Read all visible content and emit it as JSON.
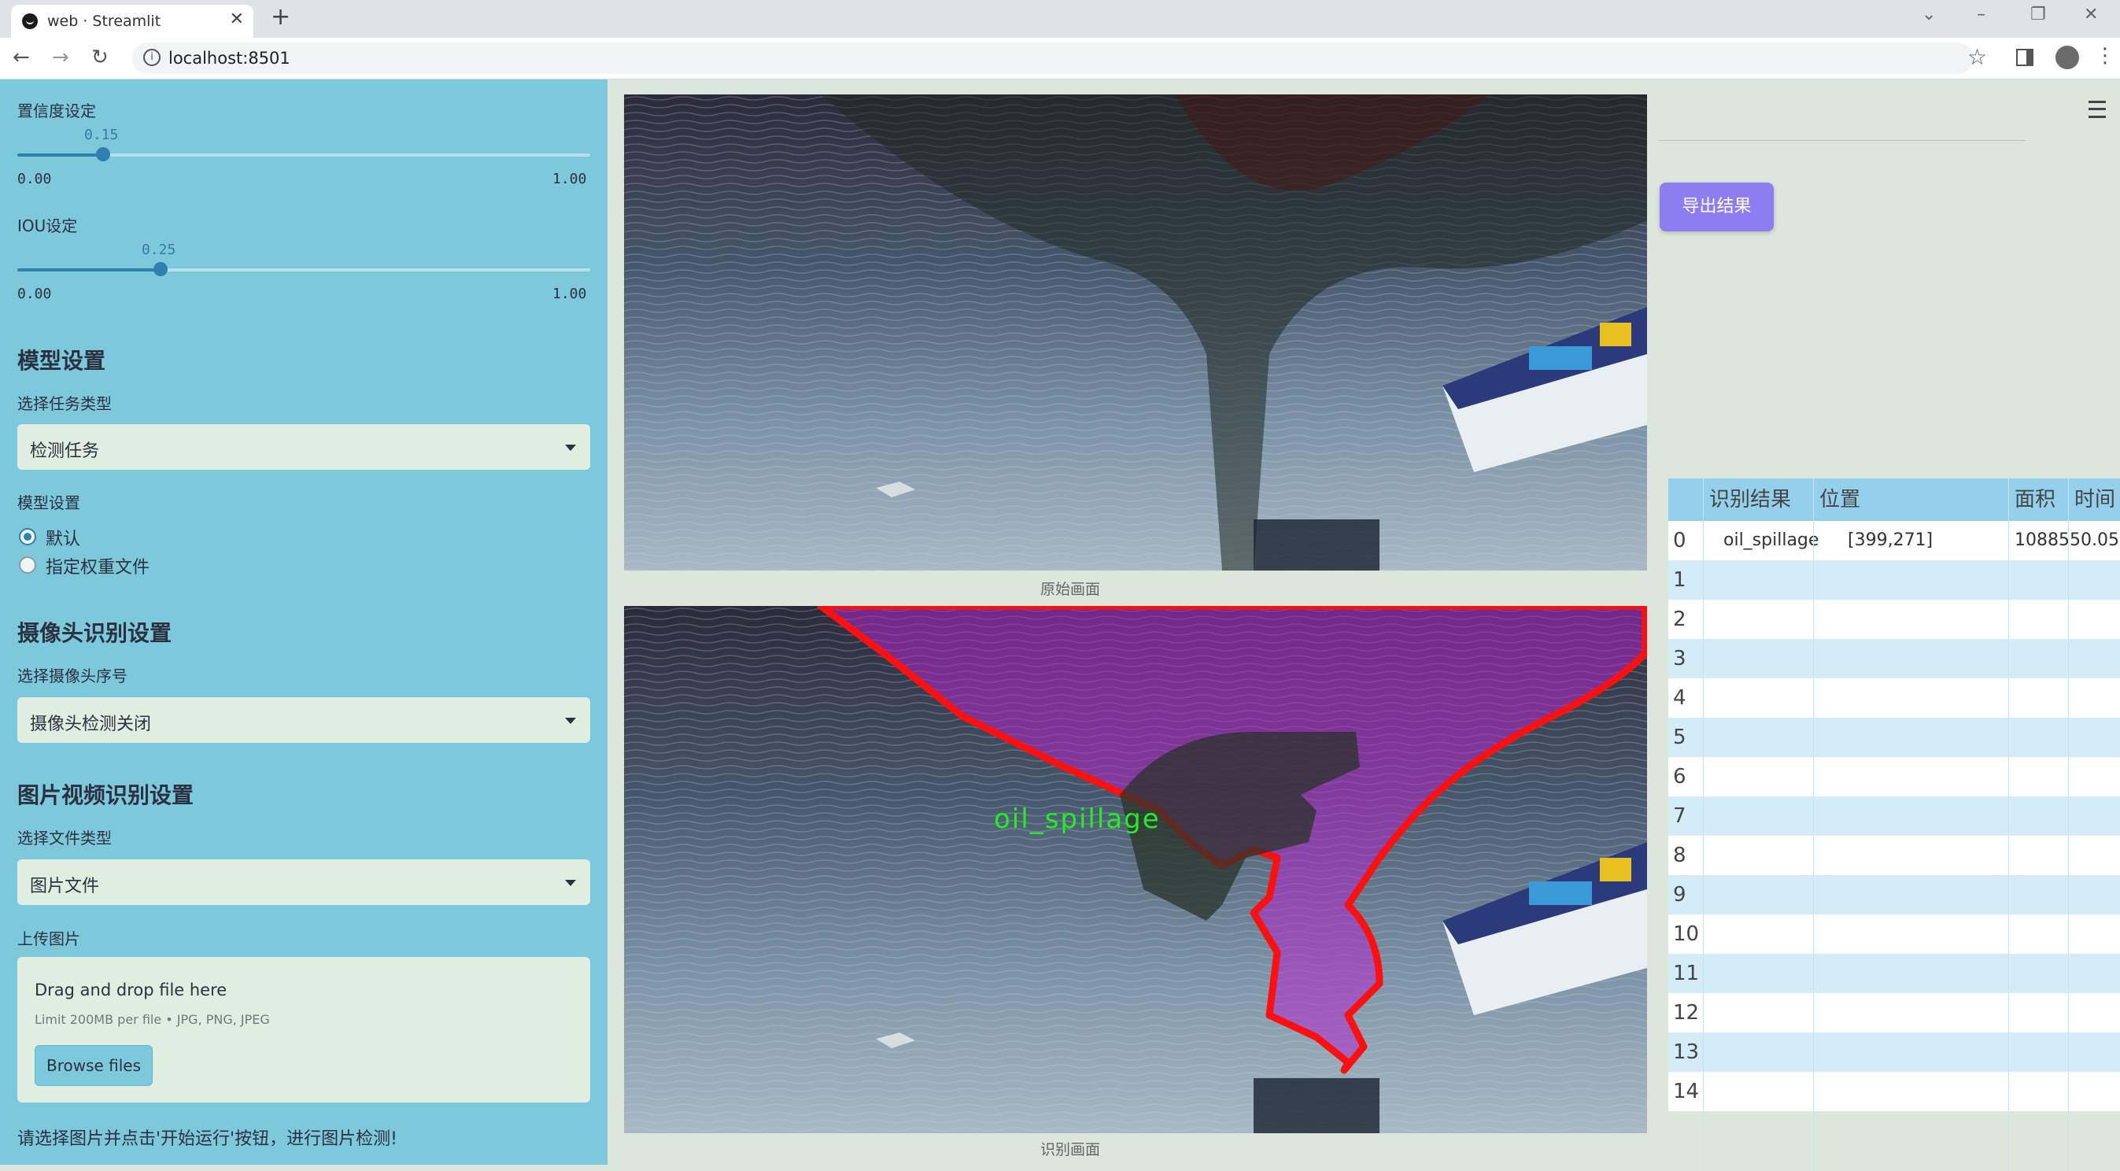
{
  "browser": {
    "tab_title": "web · Streamlit",
    "url": "localhost:8501"
  },
  "sidebar": {
    "confidence": {
      "label": "置信度设定",
      "value": 0.15,
      "value_text": "0.15",
      "min": "0.00",
      "max": "1.00"
    },
    "iou": {
      "label": "IOU设定",
      "value": 0.25,
      "value_text": "0.25",
      "min": "0.00",
      "max": "1.00"
    },
    "model_section": {
      "title": "模型设置",
      "task_label": "选择任务类型",
      "task_value": "检测任务",
      "model_label": "模型设置",
      "radio_default": "默认",
      "radio_custom": "指定权重文件"
    },
    "camera_section": {
      "title": "摄像头识别设置",
      "camera_label": "选择摄像头序号",
      "camera_value": "摄像头检测关闭"
    },
    "media_section": {
      "title": "图片视频识别设置",
      "file_type_label": "选择文件类型",
      "file_type_value": "图片文件",
      "upload_label": "上传图片",
      "drop_text": "Drag and drop file here",
      "limit_text": "Limit 200MB per file • JPG, PNG, JPEG",
      "browse_label": "Browse files"
    },
    "hint": "请选择图片并点击'开始运行'按钮，进行图片检测!"
  },
  "main": {
    "original_caption": "原始画面",
    "result_caption": "识别画面",
    "detection_label": "oil_spillage"
  },
  "right": {
    "export_label": "导出结果"
  },
  "table": {
    "headers": [
      "识别结果",
      "位置",
      "面积",
      "时间"
    ],
    "rows": [
      [
        "0",
        "oil_spillage",
        "[399,271]",
        "1088550.05",
        ""
      ],
      [
        "1",
        "",
        "",
        "",
        ""
      ],
      [
        "2",
        "",
        "",
        "",
        ""
      ],
      [
        "3",
        "",
        "",
        "",
        ""
      ],
      [
        "4",
        "",
        "",
        "",
        ""
      ],
      [
        "5",
        "",
        "",
        "",
        ""
      ],
      [
        "6",
        "",
        "",
        "",
        ""
      ],
      [
        "7",
        "",
        "",
        "",
        ""
      ],
      [
        "8",
        "",
        "",
        "",
        ""
      ],
      [
        "9",
        "",
        "",
        "",
        ""
      ],
      [
        "10",
        "",
        "",
        "",
        ""
      ],
      [
        "11",
        "",
        "",
        "",
        ""
      ],
      [
        "12",
        "",
        "",
        "",
        ""
      ],
      [
        "13",
        "",
        "",
        "",
        ""
      ],
      [
        "14",
        "",
        "",
        "",
        ""
      ]
    ]
  },
  "colors": {
    "sidebar_bg": "#7ec8dc",
    "accent": "#2f7fb0",
    "export_button": "#8d7df0",
    "table_header": "#94d0ec",
    "mask_outline": "#ff1010",
    "mask_fill": "#b026c8",
    "label_green": "#22ee22"
  }
}
